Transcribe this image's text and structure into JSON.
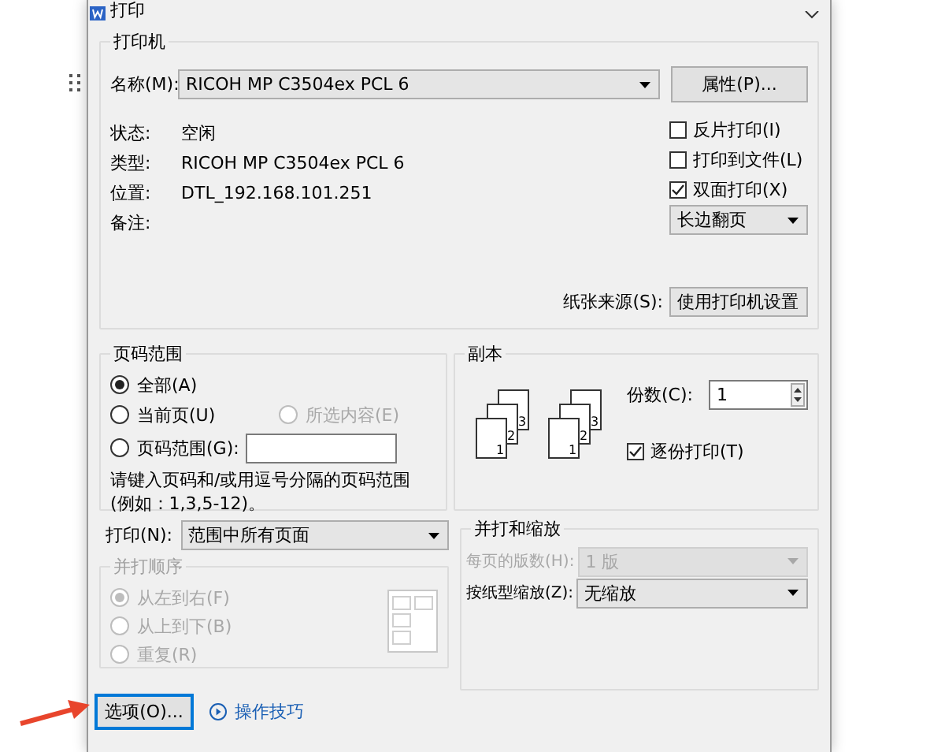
{
  "window": {
    "title": "打印"
  },
  "printer": {
    "title": "打印机",
    "name_label": "名称(M):",
    "name": "RICOH MP C3504ex PCL 6",
    "properties_button": "属性(P)...",
    "info": [
      {
        "label": "状态:",
        "value": "空闲"
      },
      {
        "label": "类型:",
        "value": "RICOH MP C3504ex PCL 6"
      },
      {
        "label": "位置:",
        "value": "DTL_192.168.101.251"
      },
      {
        "label": "备注:"
      }
    ],
    "options": [
      {
        "label": "反片打印(I)",
        "checked": false
      },
      {
        "label": "打印到文件(L)",
        "checked": false
      },
      {
        "label": "双面打印(X)",
        "checked": true
      }
    ],
    "duplex_mode": "长边翻页",
    "paper_source_label": "纸张来源(S):",
    "paper_source": "使用打印机设置"
  },
  "page_range": {
    "title": "页码范围",
    "choices": [
      {
        "label": "全部(A)",
        "selected": true,
        "disabled": false
      },
      {
        "label": "当前页(U)",
        "selected": false,
        "disabled": false
      },
      {
        "label": "所选内容(E)",
        "selected": false,
        "disabled": true
      },
      {
        "label": "页码范围(G):",
        "selected": false,
        "disabled": false
      }
    ],
    "hint": "请键入页码和/或用逗号分隔的页码范围(例如：1,3,5-12)。"
  },
  "copies": {
    "title": "副本",
    "stacks": [
      {
        "pages": [
          "1",
          "2",
          "3"
        ]
      },
      {
        "pages": [
          "1",
          "2",
          "3"
        ]
      }
    ],
    "count_label": "份数(C):",
    "count": "1",
    "collate": {
      "label": "逐份打印(T)",
      "checked": true
    }
  },
  "print_what": {
    "label": "打印(N):",
    "value": "范围中所有页面"
  },
  "order": {
    "title": "并打顺序",
    "disabled": true,
    "choices": [
      {
        "label": "从左到右(F)",
        "selected": true
      },
      {
        "label": "从上到下(B)",
        "selected": false
      },
      {
        "label": "重复(R)",
        "selected": false
      }
    ]
  },
  "zoom": {
    "title": "并打和缩放",
    "rows": [
      {
        "label": "每页的版数(H):",
        "value": "1 版",
        "disabled": true
      },
      {
        "label": "按纸型缩放(Z):",
        "value": "无缩放",
        "disabled": false
      }
    ]
  },
  "footer": {
    "options_button": "选项(O)...",
    "tips_link": "操作技巧"
  }
}
